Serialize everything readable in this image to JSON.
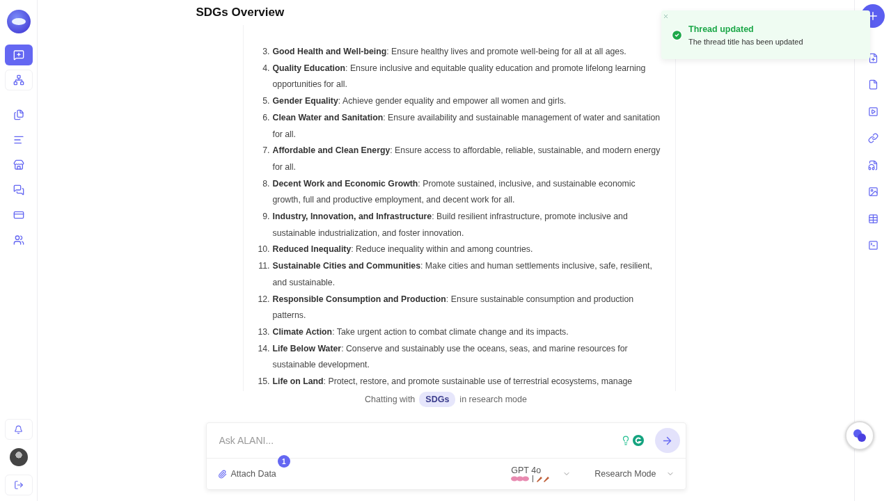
{
  "sidebar": {
    "nav": [
      {
        "selected": true
      },
      {
        "selected": false
      },
      {
        "selected": false
      },
      {
        "selected": false
      },
      {
        "selected": false
      },
      {
        "selected": false
      },
      {
        "selected": false
      },
      {
        "selected": false
      }
    ]
  },
  "thread": {
    "title": "SDGs Overview",
    "items": [
      {
        "number": "3.",
        "text": "**Good Health and Well-being**: Ensure healthy lives and promote well-being for all at all ages."
      },
      {
        "number": "4.",
        "text": "**Quality Education**: Ensure inclusive and equitable quality education and promote lifelong learning opportunities for all."
      },
      {
        "number": "5.",
        "text": "**Gender Equality**: Achieve gender equality and empower all women and girls."
      },
      {
        "number": "6.",
        "text": "**Clean Water and Sanitation**: Ensure availability and sustainable management of water and sanitation for all."
      },
      {
        "number": "7.",
        "text": "**Affordable and Clean Energy**: Ensure access to affordable, reliable, sustainable, and modern energy for all."
      },
      {
        "number": "8.",
        "text": "**Decent Work and Economic Growth**: Promote sustained, inclusive, and sustainable economic growth, full and productive employment, and decent work for all."
      },
      {
        "number": "9.",
        "text": "**Industry, Innovation, and Infrastructure**: Build resilient infrastructure, promote inclusive and sustainable industrialization, and foster innovation."
      },
      {
        "number": "10.",
        "text": "**Reduced Inequality**: Reduce inequality within and among countries."
      },
      {
        "number": "11.",
        "text": "**Sustainable Cities and Communities**: Make cities and human settlements inclusive, safe, resilient, and sustainable."
      },
      {
        "number": "12.",
        "text": "**Responsible Consumption and Production**: Ensure sustainable consumption and production patterns."
      },
      {
        "number": "13.",
        "text": "**Climate Action**: Take urgent action to combat climate change and its impacts."
      },
      {
        "number": "14.",
        "text": "**Life Below Water**: Conserve and sustainably use the oceans, seas, and marine resources for sustainable development."
      },
      {
        "number": "15.",
        "text": "**Life on Land**: Protect, restore, and promote sustainable use of terrestrial ecosystems, manage"
      }
    ]
  },
  "context": {
    "prefix": "Chatting with",
    "source": "SDGs",
    "suffix": "in research mode"
  },
  "composer": {
    "placeholder": "Ask ALANI...",
    "attach": "Attach Data",
    "attach_count": "1",
    "model": "GPT 4o",
    "mode": "Research Mode"
  },
  "toast": {
    "title": "Thread updated",
    "message": "The thread title has been updated"
  }
}
